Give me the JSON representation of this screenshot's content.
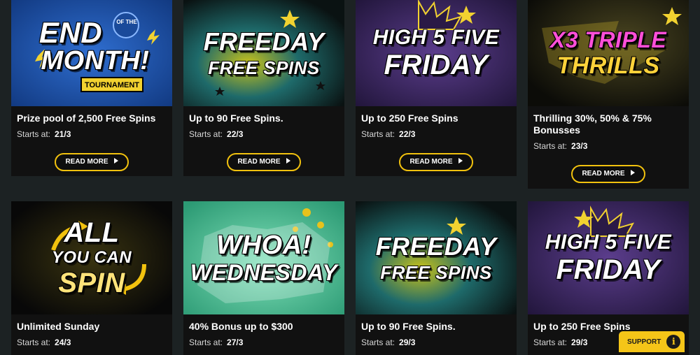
{
  "promos": [
    {
      "banner_lines": [
        "END",
        "MONTH!"
      ],
      "banner_small": [
        "OF THE",
        "TOURNAMENT"
      ],
      "title": "Prize pool of 2,500 Free Spins",
      "starts_label": "Starts at:",
      "starts_value": "21/3",
      "button": "READ MORE",
      "theme": "#1e4fa3"
    },
    {
      "banner_lines": [
        "FREEDAY",
        "FREE SPINS"
      ],
      "title": "Up to 90 Free Spins.",
      "starts_label": "Starts at:",
      "starts_value": "22/3",
      "button": "READ MORE",
      "theme": "#0c1a18"
    },
    {
      "banner_lines": [
        "HIGH 5 FIVE",
        "FRIDAY"
      ],
      "title": "Up to 250 Free Spins",
      "starts_label": "Starts at:",
      "starts_value": "22/3",
      "button": "READ MORE",
      "theme": "#3a2560"
    },
    {
      "banner_lines": [
        "X3 TRIPLE",
        "THRILLS"
      ],
      "title": "Thrilling 30%, 50% & 75% Bonusses",
      "starts_label": "Starts at:",
      "starts_value": "23/3",
      "button": "READ MORE",
      "theme": "#0f0f0c"
    },
    {
      "banner_lines": [
        "ALL",
        "YOU CAN",
        "SPIN"
      ],
      "title": "Unlimited Sunday",
      "starts_label": "Starts at:",
      "starts_value": "24/3",
      "theme": "#0c0c0c"
    },
    {
      "banner_lines": [
        "WHOA!",
        "WEDNESDAY"
      ],
      "title": "40% Bonus up to $300",
      "starts_label": "Starts at:",
      "starts_value": "27/3",
      "theme": "#3fb58d"
    },
    {
      "banner_lines": [
        "FREEDAY",
        "FREE SPINS"
      ],
      "title": "Up to 90 Free Spins.",
      "starts_label": "Starts at:",
      "starts_value": "29/3",
      "theme": "#0c1a18"
    },
    {
      "banner_lines": [
        "HIGH 5 FIVE",
        "FRIDAY"
      ],
      "title": "Up to 250 Free Spins",
      "starts_label": "Starts at:",
      "starts_value": "29/3",
      "theme": "#3a2560"
    }
  ],
  "support": {
    "label": "SUPPORT",
    "icon": "info-icon"
  }
}
